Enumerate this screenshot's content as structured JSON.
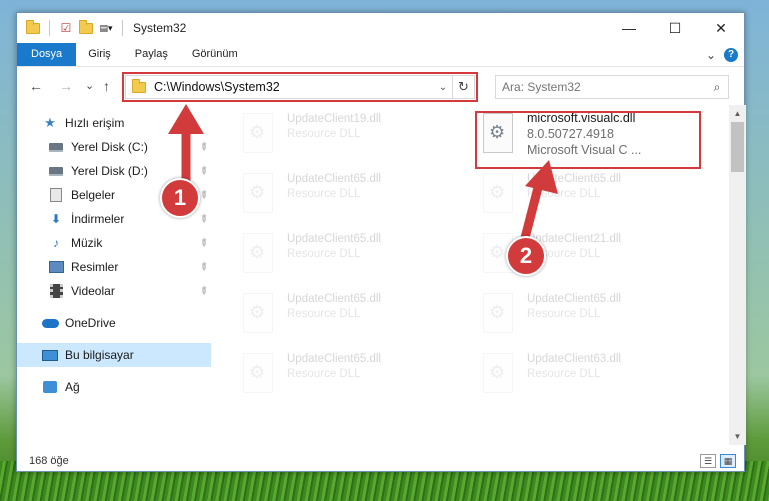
{
  "window": {
    "title": "System32",
    "controls": {
      "minimize": "—",
      "maximize": "☐",
      "close": "✕"
    }
  },
  "ribbon": {
    "tabs": [
      "Dosya",
      "Giriş",
      "Paylaş",
      "Görünüm"
    ],
    "expand": "⌄",
    "help": "?"
  },
  "nav": {
    "back": "←",
    "forward": "→",
    "recent": "⌄",
    "up": "↑",
    "address": "C:\\Windows\\System32",
    "address_dropdown": "⌄",
    "refresh": "↻",
    "search_placeholder": "Ara: System32",
    "search_icon": "⌕"
  },
  "sidebar": {
    "items": [
      {
        "label": "Hızlı erişim",
        "icon": "star-icon",
        "pinned": false
      },
      {
        "label": "Yerel Disk (C:)",
        "icon": "drive-icon",
        "pinned": true
      },
      {
        "label": "Yerel Disk (D:)",
        "icon": "drive-icon",
        "pinned": true
      },
      {
        "label": "Belgeler",
        "icon": "documents-icon",
        "pinned": true
      },
      {
        "label": "İndirmeler",
        "icon": "download-icon",
        "pinned": true
      },
      {
        "label": "Müzik",
        "icon": "music-icon",
        "pinned": true
      },
      {
        "label": "Resimler",
        "icon": "pictures-icon",
        "pinned": true
      },
      {
        "label": "Videolar",
        "icon": "videos-icon",
        "pinned": true
      },
      {
        "label": "OneDrive",
        "icon": "cloud-icon",
        "pinned": false
      },
      {
        "label": "Bu bilgisayar",
        "icon": "computer-icon",
        "pinned": false
      },
      {
        "label": "Ağ",
        "icon": "network-icon",
        "pinned": false
      }
    ],
    "pin_glyph": "📌"
  },
  "files": {
    "selected": {
      "name": "microsoft.visualc.dll",
      "version": "8.0.50727.4918",
      "description": "Microsoft Visual C ..."
    },
    "faded": [
      {
        "name": "UpdateClient19.dll",
        "type": "Resource DLL"
      },
      {
        "name": "UpdateClient65.dll",
        "type": "Resource DLL"
      },
      {
        "name": "UpdateClient65.dll",
        "type": "Resource DLL"
      },
      {
        "name": "UpdateClient65.dll",
        "type": "Resource DLL"
      },
      {
        "name": "UpdateClient65.dll",
        "type": "Resource DLL"
      },
      {
        "name": "UpdateClient65.dll",
        "type": "Resource DLL"
      },
      {
        "name": "UpdateClient21.dll",
        "type": "Resource DLL"
      },
      {
        "name": "UpdateClient65.dll",
        "type": "Resource DLL"
      },
      {
        "name": "UpdateClient63.dll",
        "type": "Resource DLL"
      }
    ]
  },
  "status": {
    "count": "168 öğe"
  },
  "callouts": {
    "one": "1",
    "two": "2"
  },
  "colors": {
    "accent": "#1979ca",
    "highlight": "#d6393c",
    "selected_bg": "#cce8ff"
  }
}
